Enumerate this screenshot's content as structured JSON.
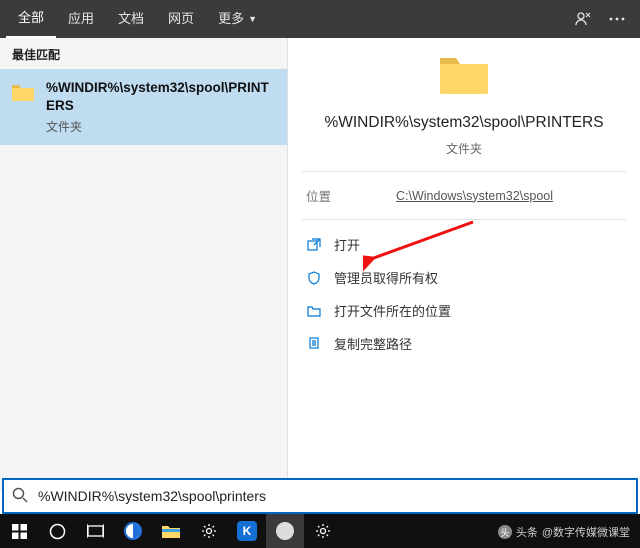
{
  "topbar": {
    "tabs": {
      "all": "全部",
      "apps": "应用",
      "docs": "文档",
      "web": "网页",
      "more": "更多"
    }
  },
  "left": {
    "section_header": "最佳匹配",
    "result": {
      "title": "%WINDIR%\\system32\\spool\\PRINTERS",
      "subtitle": "文件夹"
    }
  },
  "preview": {
    "title": "%WINDIR%\\system32\\spool\\PRINTERS",
    "subtitle": "文件夹",
    "location_label": "位置",
    "location_value": "C:\\Windows\\system32\\spool"
  },
  "actions": {
    "open": "打开",
    "admin_take_ownership": "管理员取得所有权",
    "open_file_location": "打开文件所在的位置",
    "copy_full_path": "复制完整路径"
  },
  "search": {
    "value": "%WINDIR%\\system32\\spool\\printers"
  },
  "watermark": {
    "prefix": "头条",
    "author": "@数字传媒微课堂"
  }
}
